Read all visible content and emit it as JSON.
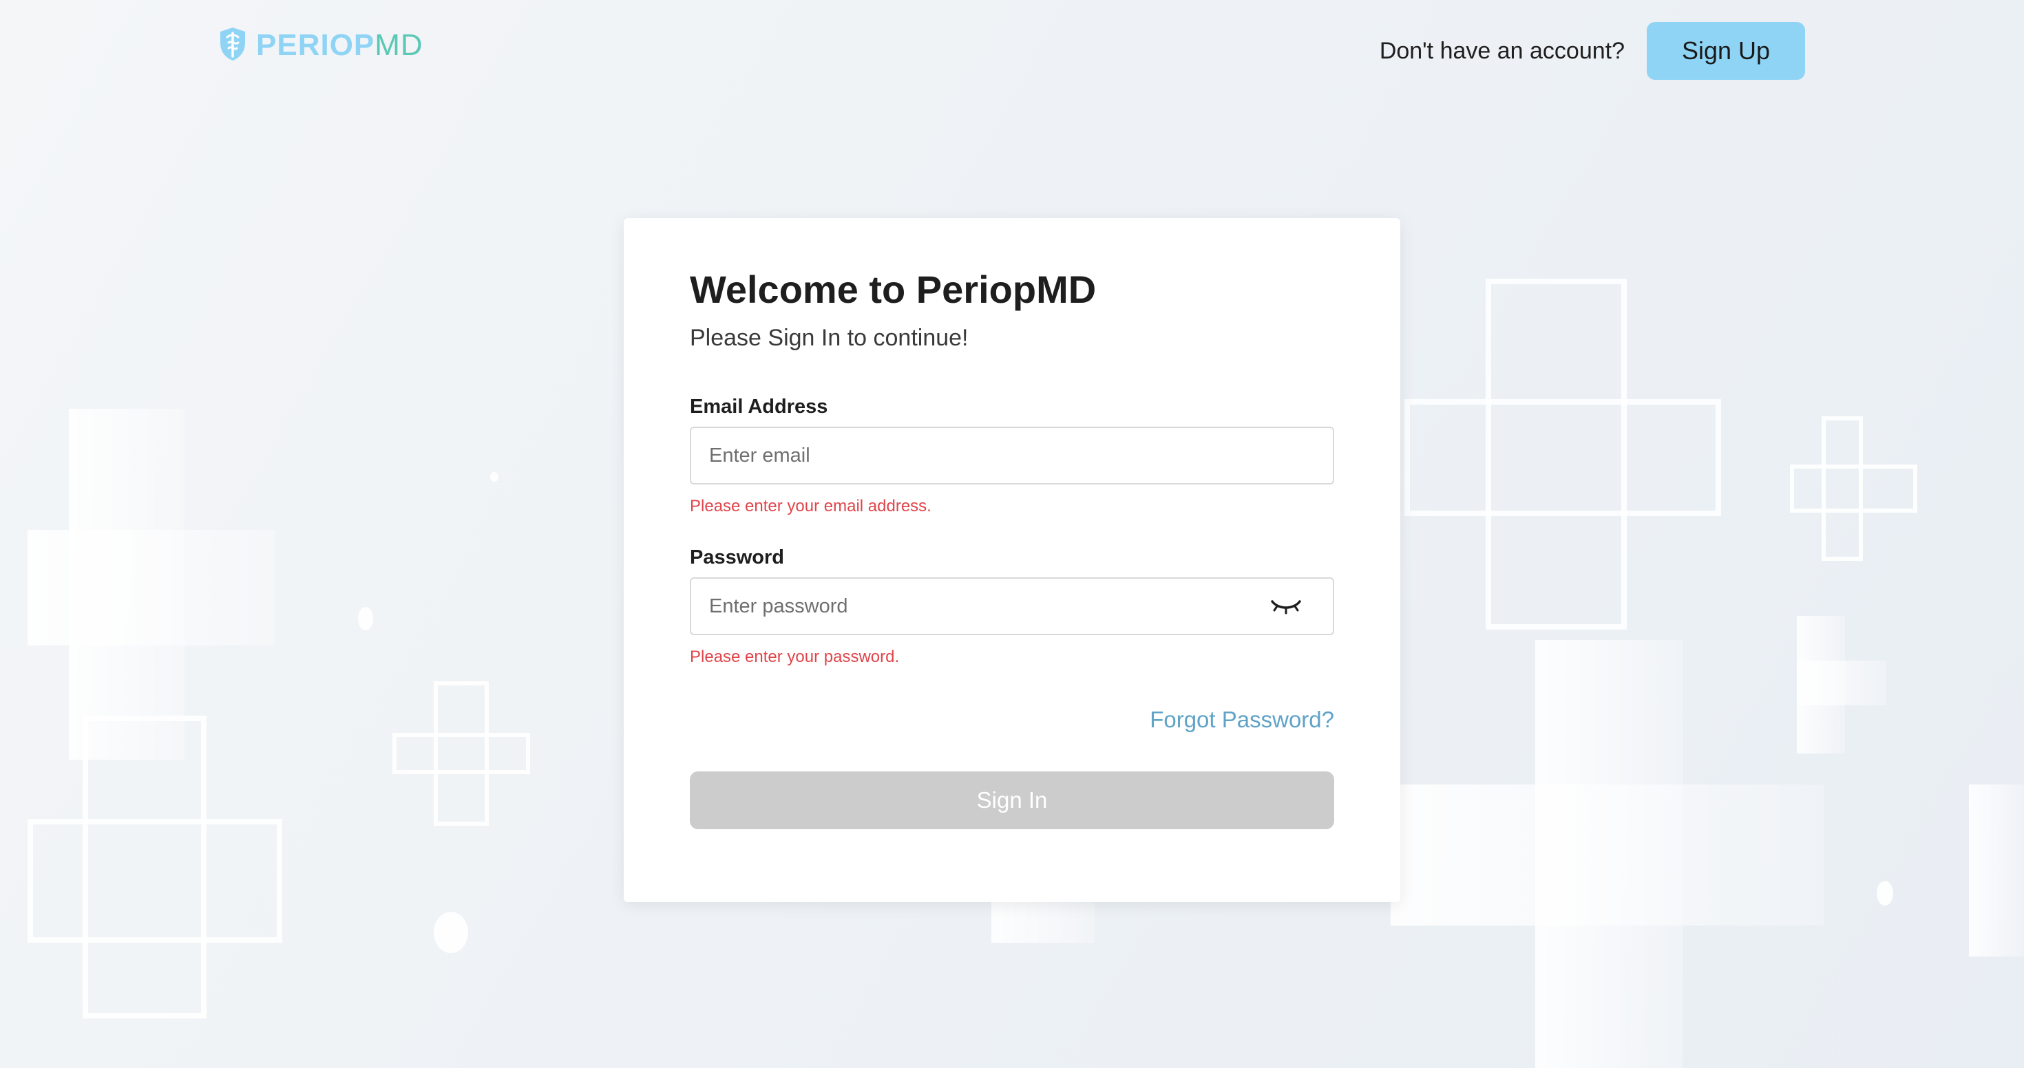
{
  "brand": {
    "name_part1": "PERIOP",
    "name_part2": "MD",
    "logo_icon": "caduceus-shield-icon",
    "colors": {
      "brand_blue": "#8fd4f5",
      "brand_teal": "#5bc8b5"
    }
  },
  "header": {
    "prompt": "Don't have an account?",
    "signup_label": "Sign Up"
  },
  "card": {
    "title": "Welcome to PeriopMD",
    "subtitle": "Please Sign In to continue!",
    "email": {
      "label": "Email Address",
      "placeholder": "Enter email",
      "value": "",
      "error": "Please enter your email address."
    },
    "password": {
      "label": "Password",
      "placeholder": "Enter password",
      "value": "",
      "toggle_icon": "eye-closed-icon",
      "error": "Please enter your password."
    },
    "forgot_label": "Forgot Password?",
    "signin_label": "Sign In"
  },
  "colors": {
    "error": "#e0454b",
    "link": "#5fa3c8",
    "disabled_button": "#cccccc"
  }
}
